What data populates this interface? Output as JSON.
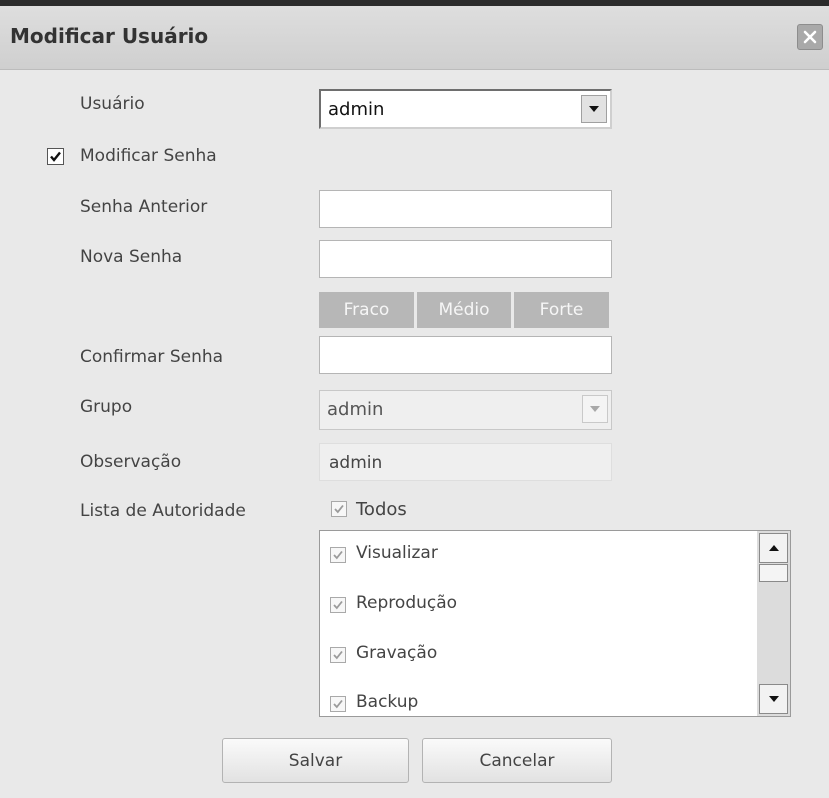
{
  "dialog": {
    "title": "Modificar Usuário"
  },
  "form": {
    "user": {
      "label": "Usuário",
      "value": "admin"
    },
    "modify_password": {
      "label": "Modificar Senha",
      "checked": true
    },
    "old_password": {
      "label": "Senha Anterior",
      "value": ""
    },
    "new_password": {
      "label": "Nova Senha",
      "value": ""
    },
    "strength": {
      "weak": "Fraco",
      "medium": "Médio",
      "strong": "Forte"
    },
    "confirm_password": {
      "label": "Confirmar Senha",
      "value": ""
    },
    "group": {
      "label": "Grupo",
      "value": "admin"
    },
    "note": {
      "label": "Observação",
      "value": "admin"
    },
    "authority": {
      "label": "Lista de Autoridade",
      "all": {
        "label": "Todos",
        "checked": true
      },
      "items": [
        {
          "label": "Visualizar",
          "checked": true
        },
        {
          "label": "Reprodução",
          "checked": true
        },
        {
          "label": "Gravação",
          "checked": true
        },
        {
          "label": "Backup",
          "checked": true
        }
      ]
    }
  },
  "buttons": {
    "save": "Salvar",
    "cancel": "Cancelar"
  }
}
